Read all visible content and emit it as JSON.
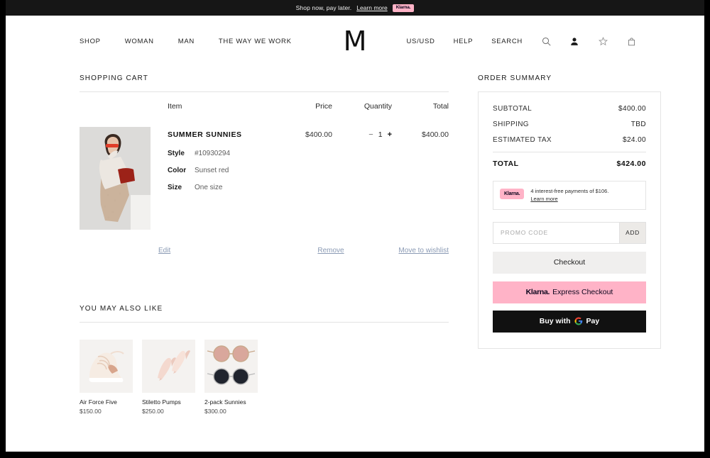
{
  "banner": {
    "text": "Shop now, pay later.",
    "link": "Learn more",
    "badge": "Klarna."
  },
  "header": {
    "logo": "M",
    "nav_left": [
      {
        "label": "SHOP"
      },
      {
        "label": "WOMAN"
      },
      {
        "label": "MAN"
      },
      {
        "label": "THE WAY WE WORK"
      }
    ],
    "nav_right": [
      {
        "label": "US/USD"
      },
      {
        "label": "HELP"
      },
      {
        "label": "SEARCH"
      }
    ],
    "icons": [
      "search-icon",
      "account-icon",
      "wishlist-star-icon",
      "shopping-bag-icon"
    ]
  },
  "cart": {
    "title": "SHOPPING CART",
    "columns": {
      "item": "Item",
      "price": "Price",
      "quantity": "Quantity",
      "total": "Total"
    },
    "item": {
      "name": "SUMMER SUNNIES",
      "price": "$400.00",
      "quantity": "1",
      "qty_minus": "−",
      "qty_plus": "+",
      "total": "$400.00",
      "attributes": [
        {
          "key": "Style",
          "value": "#10930294"
        },
        {
          "key": "Color",
          "value": "Sunset red"
        },
        {
          "key": "Size",
          "value": "One size"
        }
      ],
      "links": {
        "edit": "Edit",
        "remove": "Remove",
        "wishlist": "Move to wishlist"
      }
    }
  },
  "recommendations": {
    "title": "YOU MAY ALSO LIKE",
    "items": [
      {
        "name": "Air Force Five",
        "price": "$150.00"
      },
      {
        "name": "Stiletto Pumps",
        "price": "$250.00"
      },
      {
        "name": "2-pack Sunnies",
        "price": "$300.00"
      }
    ]
  },
  "summary": {
    "title": "ORDER SUMMARY",
    "lines": [
      {
        "label": "SUBTOTAL",
        "value": "$400.00"
      },
      {
        "label": "SHIPPING",
        "value": "TBD"
      },
      {
        "label": "ESTIMATED TAX",
        "value": "$24.00"
      }
    ],
    "total_label": "TOTAL",
    "total_value": "$424.00",
    "klarna_promo": {
      "badge": "Klarna.",
      "text": "4 interest-free payments of $106.",
      "link": "Learn more"
    },
    "promo": {
      "placeholder": "PROMO CODE",
      "value": "",
      "add_label": "ADD"
    },
    "buttons": {
      "checkout": "Checkout",
      "klarna_word": "Klarna.",
      "klarna_rest": "Express Checkout",
      "gpay_prefix": "Buy with",
      "gpay_g": "G",
      "gpay_pay": "Pay"
    }
  },
  "colors": {
    "klarna_pink": "#ffb3c7",
    "link_blue": "#8a9ab4",
    "banner_black": "#161616",
    "gpay_black": "#111111"
  }
}
